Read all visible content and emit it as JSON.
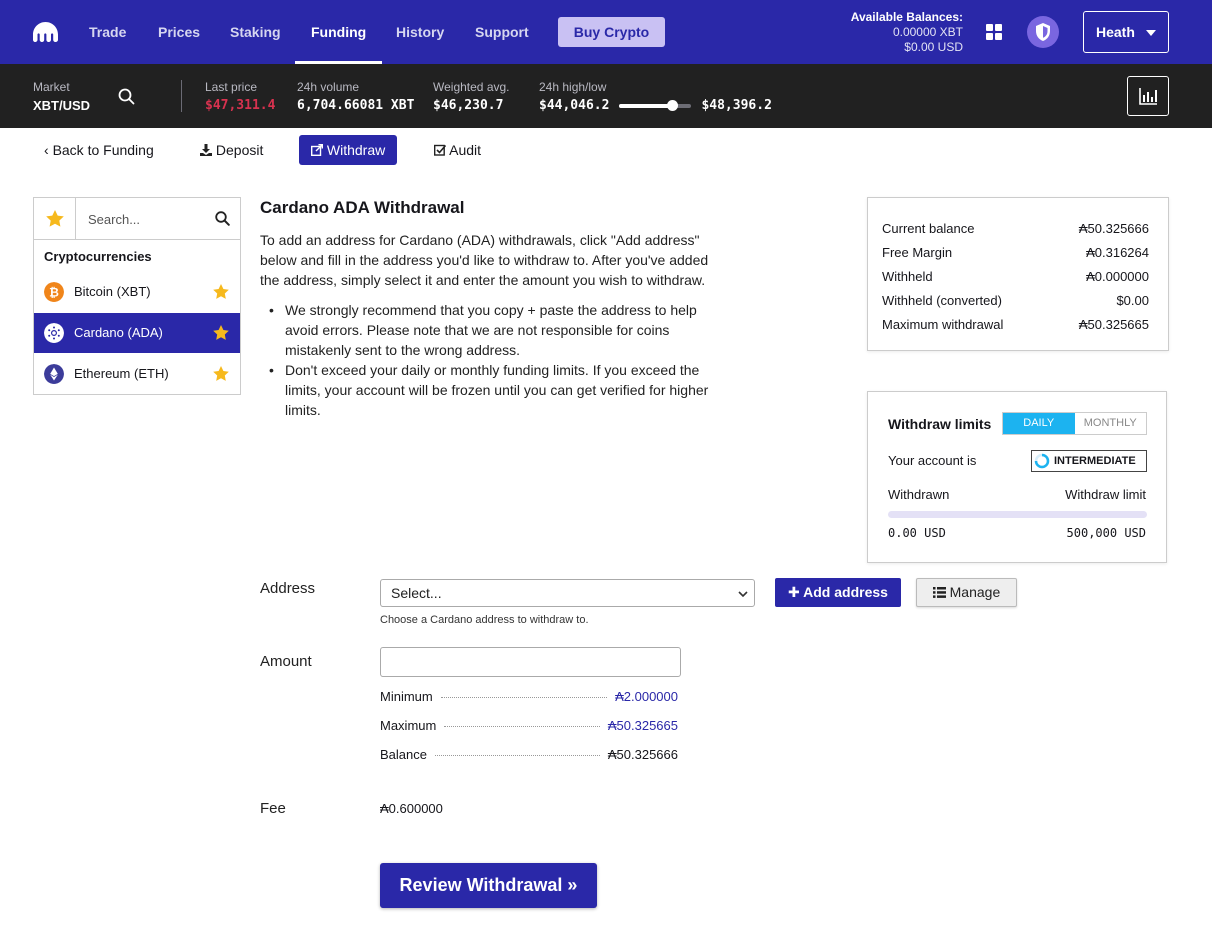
{
  "nav": {
    "items": [
      "Trade",
      "Prices",
      "Staking",
      "Funding",
      "History",
      "Support"
    ],
    "buy_label": "Buy Crypto",
    "balances_title": "Available Balances:",
    "balance_xbt": "0.00000 XBT",
    "balance_usd": "$0.00 USD",
    "user_name": "Heath"
  },
  "market": {
    "market_label": "Market",
    "pair": "XBT/USD",
    "last_price_label": "Last price",
    "last_price": "$47,311.4",
    "volume_label": "24h volume",
    "volume": "6,704.66081 XBT",
    "weighted_label": "Weighted avg.",
    "weighted": "$46,230.7",
    "highlow_label": "24h high/low",
    "low": "$44,046.2",
    "high": "$48,396.2"
  },
  "subnav": {
    "back": "Back to Funding",
    "deposit": "Deposit",
    "withdraw": "Withdraw",
    "audit": "Audit"
  },
  "sidebar": {
    "search_placeholder": "Search...",
    "heading": "Cryptocurrencies",
    "coins": [
      {
        "name": "Bitcoin",
        "ticker": "(XBT)"
      },
      {
        "name": "Cardano",
        "ticker": "(ADA)"
      },
      {
        "name": "Ethereum",
        "ticker": "(ETH)"
      }
    ]
  },
  "main": {
    "title": "Cardano ADA Withdrawal",
    "intro": "To add an address for Cardano (ADA) withdrawals, click \"Add address\" below and fill in the address you'd like to withdraw to. After you've added the address, simply select it and enter the amount you wish to withdraw.",
    "bullet1": "We strongly recommend that you copy + paste the address to help avoid errors. Please note that we are not responsible for coins mistakenly sent to the wrong address.",
    "bullet2": "Don't exceed your daily or monthly funding limits. If you exceed the limits, your account will be frozen until you can get verified for higher limits."
  },
  "balance_box": {
    "rows": [
      {
        "label": "Current balance",
        "value": "₳50.325666"
      },
      {
        "label": "Free Margin",
        "value": "₳0.316264"
      },
      {
        "label": "Withheld",
        "value": "₳0.000000"
      },
      {
        "label": "Withheld (converted)",
        "value": "$0.00"
      },
      {
        "label": "Maximum withdrawal",
        "value": "₳50.325665"
      }
    ]
  },
  "limits": {
    "title": "Withdraw limits",
    "daily": "DAILY",
    "monthly": "MONTHLY",
    "account_label": "Your account is",
    "level": "INTERMEDIATE",
    "withdrawn_label": "Withdrawn",
    "limit_label": "Withdraw limit",
    "withdrawn_value": "0.00 USD",
    "limit_value": "500,000 USD",
    "progress_fraction": 0
  },
  "form": {
    "address_label": "Address",
    "address_select": "Select...",
    "address_hint": "Choose a Cardano address to withdraw to.",
    "add_address": "Add address",
    "manage": "Manage",
    "amount_label": "Amount",
    "amount_value": "",
    "minimum_label": "Minimum",
    "minimum_value": "₳2.000000",
    "maximum_label": "Maximum",
    "maximum_value": "₳50.325665",
    "balance_label": "Balance",
    "balance_value": "₳50.325666",
    "fee_label": "Fee",
    "fee_value": "₳0.600000",
    "review": "Review Withdrawal »"
  },
  "colors": {
    "brand": "#2a28a8",
    "market_bar": "#212121",
    "price_red": "#d8324f",
    "daily_toggle": "#1cb3f0",
    "star": "#f6b91d"
  }
}
